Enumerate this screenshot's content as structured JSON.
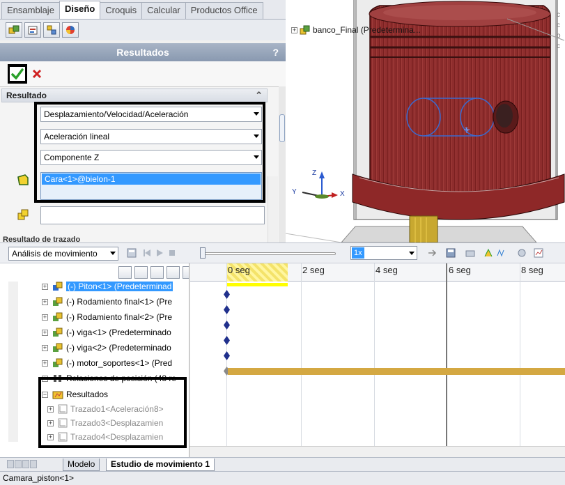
{
  "command_tabs": [
    "Ensamblaje",
    "Diseño",
    "Croquis",
    "Calcular",
    "Productos Office"
  ],
  "active_command_tab": "Diseño",
  "property_manager": {
    "title": "Resultados",
    "help": "?",
    "section_title": "Resultado",
    "result_type": "Desplazamiento/Velocidad/Aceleración",
    "subtype": "Aceleración lineal",
    "component": "Componente Z",
    "selected_entity": "Cara<1>@bielon-1",
    "next_section_partial": "Resultado de trazado"
  },
  "viewport": {
    "tree_root_label": "banco_Final  (Predetermina...",
    "triad_labels": {
      "x": "X",
      "y": "Y",
      "z": "Z"
    },
    "side_glyphs": [
      "c",
      "c",
      "o",
      "c"
    ]
  },
  "motion_toolbar": {
    "study_type": "Análisis de movimiento",
    "playback_speed": "1x"
  },
  "motion_tree": {
    "rows": [
      {
        "label": "(-) Piton<1> (Predeterminad",
        "selected": true
      },
      {
        "label": "(-) Rodamiento final<1> (Pre",
        "selected": false
      },
      {
        "label": "(-) Rodamiento final<2> (Pre",
        "selected": false
      },
      {
        "label": "(-) viga<1> (Predeterminado",
        "selected": false
      },
      {
        "label": "(-) viga<2> (Predeterminado",
        "selected": false
      },
      {
        "label": "(-) motor_soportes<1> (Pred",
        "selected": false
      }
    ],
    "mates_label": "Relaciones de posición (48 re",
    "results_folder": "Resultados",
    "plots": [
      "Trazado1<Aceleración8>",
      "Trazado3<Desplazamien",
      "Trazado4<Desplazamien"
    ]
  },
  "timeline": {
    "ticks": [
      "0 seg",
      "2 seg",
      "4 seg",
      "6 seg",
      "8 seg"
    ]
  },
  "bottom_tabs": [
    "Modelo",
    "Estudio de movimiento 1"
  ],
  "active_bottom_tab": "Estudio de movimiento 1",
  "status": "Camara_piston<1>",
  "colors": {
    "title_bar": "#8e9db3",
    "selection_blue": "#3399ff",
    "piston_red": "#8a2a2a",
    "timeline_bar": "#d4a842",
    "key_blue": "#20308c"
  }
}
